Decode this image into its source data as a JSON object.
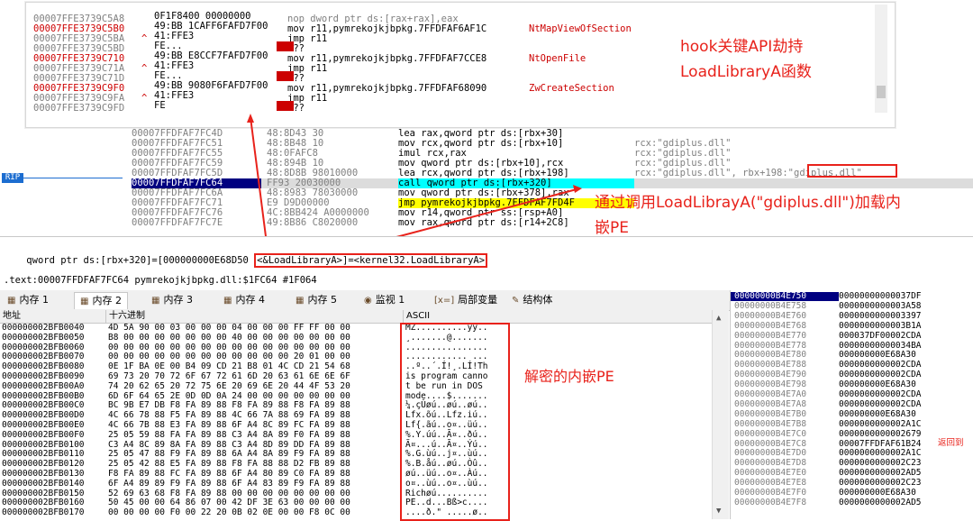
{
  "popup": {
    "rows": [
      {
        "addr": "00007FFE3739C5A8",
        "addr_color": "gray",
        "mark": "",
        "bytes": "0F1F8400 00000000",
        "instr": "nop dword ptr ds:[rax+rax],eax",
        "comment": ""
      },
      {
        "addr": "00007FFE3739C5B0",
        "addr_color": "red",
        "mark": "",
        "bytes": "49:BB 1CAFF6FAFD7F00",
        "instr": "mov r11,pymrekojkjbpkg.7FFDFAF6AF1C",
        "comment": "NtMapViewOfSection"
      },
      {
        "addr": "00007FFE3739C5BA",
        "addr_color": "gray",
        "mark": "^",
        "bytes": "41:FFE3",
        "instr": "jmp r11",
        "comment": ""
      },
      {
        "addr": "00007FFE3739C5BD",
        "addr_color": "gray",
        "mark": "",
        "bytes": "FE...",
        "instr": "???",
        "comment": ""
      },
      {
        "addr": "00007FFE3739C710",
        "addr_color": "red",
        "mark": "",
        "bytes": "49:BB E8CCF7FAFD7F00",
        "instr": "mov r11,pymrekojkjbpkg.7FFDFAF7CCE8",
        "comment": "NtOpenFile"
      },
      {
        "addr": "00007FFE3739C71A",
        "addr_color": "gray",
        "mark": "^",
        "bytes": "41:FFE3",
        "instr": "jmp r11",
        "comment": ""
      },
      {
        "addr": "00007FFE3739C71D",
        "addr_color": "gray",
        "mark": "",
        "bytes": "FE...",
        "instr": "???",
        "comment": ""
      },
      {
        "addr": "00007FFE3739C9F0",
        "addr_color": "red",
        "mark": "",
        "bytes": "49:BB 9080F6FAFD7F00",
        "instr": "mov r11,pymrekojkjbpkg.7FFDFAF68090",
        "comment": "ZwCreateSection"
      },
      {
        "addr": "00007FFE3739C9FA",
        "addr_color": "gray",
        "mark": "^",
        "bytes": "41:FFE3",
        "instr": "jmp r11",
        "comment": ""
      },
      {
        "addr": "00007FFE3739C9FD",
        "addr_color": "gray",
        "mark": "",
        "bytes": "FE",
        "instr": "???",
        "comment": ""
      }
    ]
  },
  "annotations": {
    "hook_line1": "hook关键API劫持",
    "hook_line2": "LoadLibraryA函数",
    "load_line1": "通过调用LoadLibrayA(\"gdiplus.dll\")加载内",
    "load_line2": "嵌PE",
    "decrypt": "解密的内嵌PE"
  },
  "disasm": {
    "rip_label": "RIP",
    "rows": [
      {
        "addr": "00007FFDFAF7FC4D",
        "bytes": "48:8D43 30",
        "instr": "lea rax,qword ptr ds:[rbx+30]",
        "comment": ""
      },
      {
        "addr": "00007FFDFAF7FC51",
        "bytes": "48:8B48 10",
        "instr": "mov rcx,qword ptr ds:[rbx+10]",
        "comment": "rcx:\"gdiplus.dll\""
      },
      {
        "addr": "00007FFDFAF7FC55",
        "bytes": "48:0FAFC8",
        "instr": "imul rcx,rax",
        "comment": "rcx:\"gdiplus.dll\""
      },
      {
        "addr": "00007FFDFAF7FC59",
        "bytes": "48:894B 10",
        "instr": "mov qword ptr ds:[rbx+10],rcx",
        "comment": "rcx:\"gdiplus.dll\""
      },
      {
        "addr": "00007FFDFAF7FC5D",
        "bytes": "48:8D8B 98010000",
        "instr": "lea rcx,qword ptr ds:[rbx+198]",
        "comment": "rcx:\"gdiplus.dll\", rbx+198:\"gdiplus.dll\""
      },
      {
        "addr": "00007FFDFAF7FC64",
        "bytes": "FF93 20030000",
        "instr": "call qword ptr ds:[rbx+320]",
        "comment": ""
      },
      {
        "addr": "00007FFDFAF7FC6A",
        "bytes": "48:8983 78030000",
        "instr": "mov qword ptr ds:[rbx+378],rax",
        "comment": ""
      },
      {
        "addr": "00007FFDFAF7FC71",
        "bytes": "E9 D9D00000",
        "instr": "jmp pymrekojkjbpkg.7FFDFAF7FD4F",
        "comment": ""
      },
      {
        "addr": "00007FFDFAF7FC76",
        "bytes": "4C:8BB424 A0000000",
        "instr": "mov r14,qword ptr ss:[rsp+A0]",
        "comment": ""
      },
      {
        "addr": "00007FFDFAF7FC7E",
        "bytes": "49:8B86 C8020000",
        "instr": "mov rax,qword ptr ds:[r14+2C8]",
        "comment": ""
      }
    ]
  },
  "status": {
    "line1_prefix": "qword ptr ds:[rbx+320]=[000000000E68D50 ",
    "line1_boxed": "<&LoadLibraryA>]=<kernel32.LoadLibraryA>",
    "line2": ".text:00007FFDFAF7FC64 pymrekojkjbpkg.dll:$1FC64 #1F064"
  },
  "tabs": [
    {
      "label": "内存 1",
      "icon": "memory-icon"
    },
    {
      "label": "内存 2",
      "icon": "memory-icon"
    },
    {
      "label": "内存 3",
      "icon": "memory-icon"
    },
    {
      "label": "内存 4",
      "icon": "memory-icon"
    },
    {
      "label": "内存 5",
      "icon": "memory-icon"
    },
    {
      "label": "监视 1",
      "icon": "watch-icon"
    },
    {
      "label": "局部变量",
      "icon": "locals-icon"
    },
    {
      "label": "结构体",
      "icon": "struct-icon"
    }
  ],
  "hex": {
    "col_addr": "地址",
    "col_hex": "十六进制",
    "col_ascii": "ASCII",
    "rows": [
      {
        "addr": "000000002BFB0040",
        "bytes": "4D 5A 90 00 03 00 00 00 04 00 00 00 FF FF 00 00",
        "ascii": "MZ..........ÿÿ.."
      },
      {
        "addr": "000000002BFB0050",
        "bytes": "B8 00 00 00 00 00 00 00 40 00 00 00 00 00 00 00",
        "ascii": "¸.......@......."
      },
      {
        "addr": "000000002BFB0060",
        "bytes": "00 00 00 00 00 00 00 00 00 00 00 00 00 00 00 00",
        "ascii": "................"
      },
      {
        "addr": "000000002BFB0070",
        "bytes": "00 00 00 00 00 00 00 00 00 00 00 00 20 01 00 00",
        "ascii": "............ ..."
      },
      {
        "addr": "000000002BFB0080",
        "bytes": "0E 1F BA 0E 00 B4 09 CD 21 B8 01 4C CD 21 54 68",
        "ascii": "..º..´.Í!¸.LÍ!Th"
      },
      {
        "addr": "000000002BFB0090",
        "bytes": "69 73 20 70 72 6F 67 72 61 6D 20 63 61 6E 6E 6F",
        "ascii": "is program canno"
      },
      {
        "addr": "000000002BFB00A0",
        "bytes": "74 20 62 65 20 72 75 6E 20 69 6E 20 44 4F 53 20",
        "ascii": "t be run in DOS "
      },
      {
        "addr": "000000002BFB00B0",
        "bytes": "6D 6F 64 65 2E 0D 0D 0A 24 00 00 00 00 00 00 00",
        "ascii": "mode....$......."
      },
      {
        "addr": "000000002BFB00C0",
        "bytes": "BC 9B E7 DB F8 FA 89 88 F8 FA 89 88 F8 FA 89 88",
        "ascii": "¼.çÛøú..øú..øú.."
      },
      {
        "addr": "000000002BFB00D0",
        "bytes": "4C 66 78 88 F5 FA 89 88 4C 66 7A 88 69 FA 89 88",
        "ascii": "Lfx.õú..Lfz.iú.."
      },
      {
        "addr": "000000002BFB00E0",
        "bytes": "4C 66 7B 88 E3 FA 89 88 6F A4 8C 89 FC FA 89 88",
        "ascii": "Lf{.ãú..o¤..üú.."
      },
      {
        "addr": "000000002BFB00F0",
        "bytes": "25 05 59 88 FA FA 89 88 C3 A4 8A 89 F0 FA 89 88",
        "ascii": "%.Y.úú..Ã¤..ðú.."
      },
      {
        "addr": "000000002BFB0100",
        "bytes": "C3 A4 8C 89 8A FA 89 88 C3 A4 8D 89 DD FA 89 88",
        "ascii": "Ã¤...ú..Ã¤..Ýú.."
      },
      {
        "addr": "000000002BFB0110",
        "bytes": "25 05 47 88 F9 FA 89 88 6A A4 8A 89 F9 FA 89 88",
        "ascii": "%.G.ùú..j¤..ùú.."
      },
      {
        "addr": "000000002BFB0120",
        "bytes": "25 05 42 88 E5 FA 89 88 F8 FA 88 88 D2 FB 89 88",
        "ascii": "%.B.åú..øú..Òû.."
      },
      {
        "addr": "000000002BFB0130",
        "bytes": "F8 FA 89 88 FC FA 89 88 6F A4 80 89 C0 FA 89 88",
        "ascii": "øú..üú..o¤..Àú.."
      },
      {
        "addr": "000000002BFB0140",
        "bytes": "6F A4 89 89 F9 FA 89 88 6F A4 83 89 F9 FA 89 88",
        "ascii": "o¤..ùú..o¤..ùú.."
      },
      {
        "addr": "000000002BFB0150",
        "bytes": "52 69 63 68 F8 FA 89 88 00 00 00 00 00 00 00 00",
        "ascii": "Richøú.........."
      },
      {
        "addr": "000000002BFB0160",
        "bytes": "50 45 00 00 64 86 07 00 42 DF 3E 63 00 00 00 00",
        "ascii": "PE..d...Bß>c...."
      },
      {
        "addr": "000000002BFB0170",
        "bytes": "00 00 00 00 F0 00 22 20 0B 02 0E 00 00 F8 0C 00",
        "ascii": "....ð.\" .....ø.."
      }
    ]
  },
  "stack": {
    "rows": [
      {
        "addr": "00000000B4E750",
        "val": "00000000000037DF"
      },
      {
        "addr": "00000000B4E758",
        "val": "0000000000003A58"
      },
      {
        "addr": "00000000B4E760",
        "val": "0000000000003397"
      },
      {
        "addr": "00000000B4E768",
        "val": "0000000000003B1A"
      },
      {
        "addr": "00000000B4E770",
        "val": "000037DF00002CDA"
      },
      {
        "addr": "00000000B4E778",
        "val": "00000000000034BA"
      },
      {
        "addr": "00000000B4E780",
        "val": "000000000E68A30"
      },
      {
        "addr": "00000000B4E788",
        "val": "0000000000002CDA"
      },
      {
        "addr": "00000000B4E790",
        "val": "0000000000002CDA"
      },
      {
        "addr": "00000000B4E798",
        "val": "000000000E68A30"
      },
      {
        "addr": "00000000B4E7A0",
        "val": "0000000000002CDA"
      },
      {
        "addr": "00000000B4E7A8",
        "val": "0000000000002CDA"
      },
      {
        "addr": "00000000B4E7B0",
        "val": "000000000E68A30"
      },
      {
        "addr": "00000000B4E7B8",
        "val": "0000000000002A1C"
      },
      {
        "addr": "00000000B4E7C0",
        "val": "0000000000002679"
      },
      {
        "addr": "00000000B4E7C8",
        "val": "00007FFDFAF61B24"
      },
      {
        "addr": "00000000B4E7D0",
        "val": "0000000000002A1C"
      },
      {
        "addr": "00000000B4E7D8",
        "val": "0000000000002C23"
      },
      {
        "addr": "00000000B4E7E0",
        "val": "0000000000002AD5"
      },
      {
        "addr": "00000000B4E7E8",
        "val": "0000000000002C23"
      },
      {
        "addr": "00000000B4E7F0",
        "val": "000000000E68A30"
      },
      {
        "addr": "00000000B4E7F8",
        "val": "0000000000002AD5"
      }
    ],
    "return_label": "返回到"
  },
  "colors": {
    "annot_red": "#e8221b",
    "rip_blue": "#000080",
    "hl_yellow": "#ffff00"
  }
}
